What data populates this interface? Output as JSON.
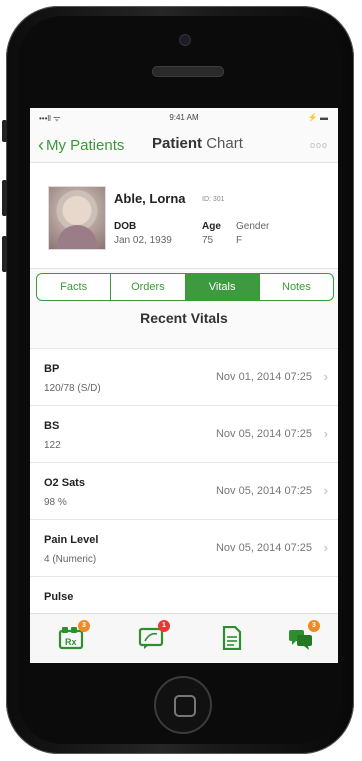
{
  "status_bar": {
    "signal": "•••ll ᯤ",
    "time": "9:41 AM",
    "battery": "⚡ ▬"
  },
  "nav": {
    "back_label": "My Patients",
    "title_bold": "Patient",
    "title_light": "Chart",
    "more_label": "ooo"
  },
  "patient": {
    "name": "Able, Lorna",
    "id_label": "ID: 301",
    "dob_label": "DOB",
    "dob_value": "Jan 02, 1939",
    "age_label": "Age",
    "age_value": "75",
    "gender_label": "Gender",
    "gender_value": "F"
  },
  "tabs": [
    {
      "label": "Facts",
      "active": false
    },
    {
      "label": "Orders",
      "active": false
    },
    {
      "label": "Vitals",
      "active": true
    },
    {
      "label": "Notes",
      "active": false
    }
  ],
  "section_title": "Recent Vitals",
  "vitals": [
    {
      "name": "BP",
      "value": "120/78 (S/D)",
      "date": "Nov 01, 2014 07:25"
    },
    {
      "name": "BS",
      "value": "122",
      "date": "Nov 05, 2014 07:25"
    },
    {
      "name": "O2 Sats",
      "value": "98 %",
      "date": "Nov 05, 2014 07:25"
    },
    {
      "name": "Pain Level",
      "value": "4 (Numeric)",
      "date": "Nov 05, 2014 07:25"
    },
    {
      "name": "Pulse",
      "value": "",
      "date": ""
    }
  ],
  "tabbar": [
    {
      "icon": "rx-icon",
      "badge": "3",
      "badge_color": "#f08a24"
    },
    {
      "icon": "chat-icon",
      "badge": "1",
      "badge_color": "#e53935"
    },
    {
      "icon": "document-icon",
      "badge": "",
      "badge_color": ""
    },
    {
      "icon": "messages-icon",
      "badge": "3",
      "badge_color": "#f08a24"
    }
  ],
  "colors": {
    "accent": "#3a9a3a",
    "active_tab": "#3d9a3f"
  }
}
